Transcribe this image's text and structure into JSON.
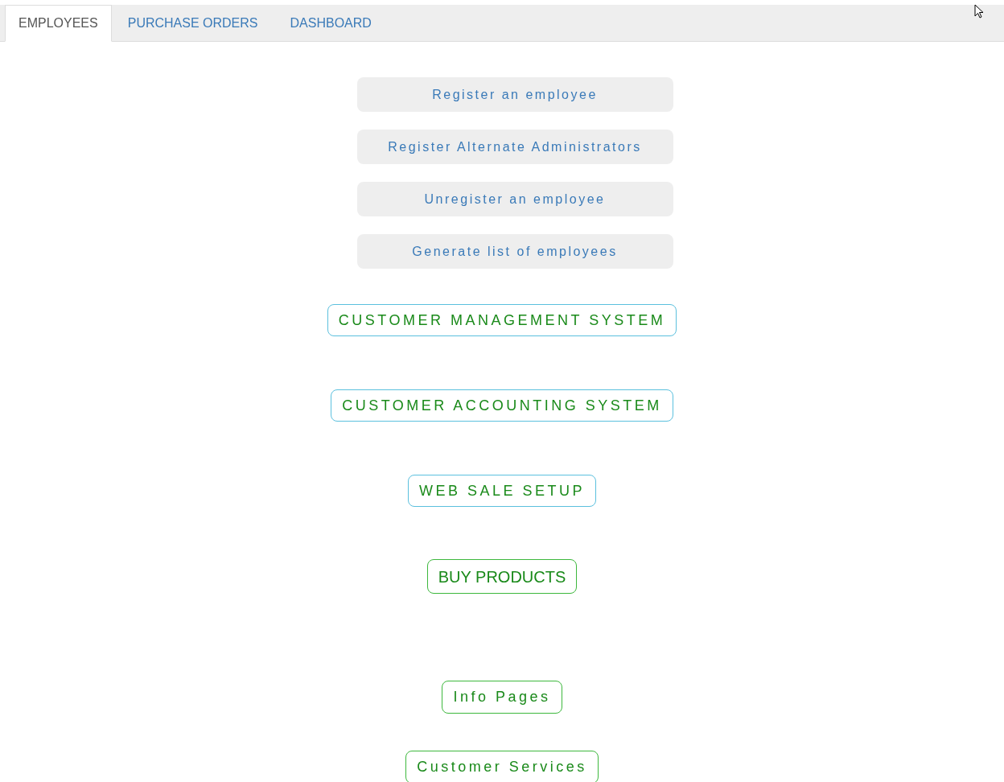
{
  "tabs": [
    {
      "label": "EMPLOYEES",
      "selected": true
    },
    {
      "label": "PURCHASE ORDERS",
      "selected": false
    },
    {
      "label": "DASHBOARD",
      "selected": false
    }
  ],
  "employee_actions": [
    "Register an employee",
    "Register Alternate Administrators",
    "Unregister an employee",
    "Generate list of employees"
  ],
  "links": [
    {
      "label": "CUSTOMER MANAGEMENT SYSTEM",
      "kind": "system"
    },
    {
      "label": "CUSTOMER ACCOUNTING SYSTEM",
      "kind": "system"
    },
    {
      "label": "WEB SALE SETUP",
      "kind": "system"
    },
    {
      "label": "BUY PRODUCTS",
      "kind": "plain"
    },
    {
      "label": "Info Pages",
      "kind": "spaced"
    },
    {
      "label": "Customer Services",
      "kind": "spaced"
    }
  ]
}
